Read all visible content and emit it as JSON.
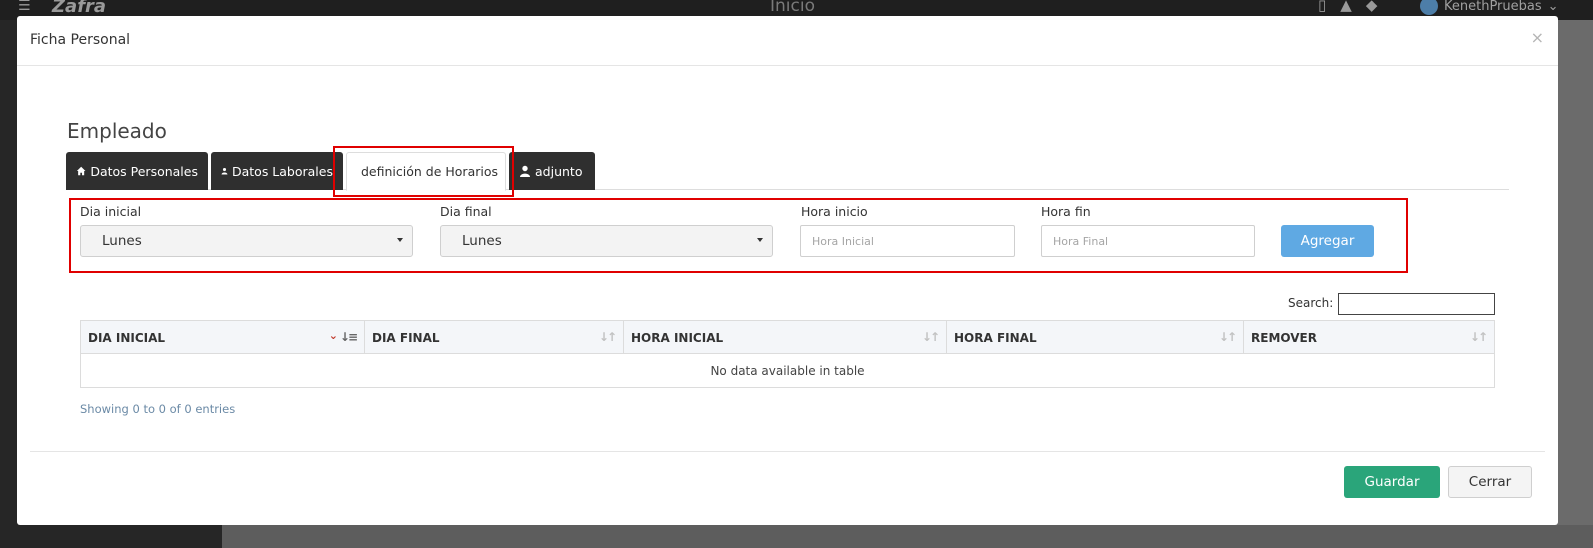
{
  "app": {
    "logo": "Zafra",
    "page_title": "Inicio",
    "user": "KenethPruebas"
  },
  "modal": {
    "title": "Ficha Personal",
    "close": "×"
  },
  "section_title": "Empleado",
  "tabs": [
    {
      "label": "Datos Personales",
      "icon": "home-icon"
    },
    {
      "label": "Datos Laborales",
      "icon": "user-icon"
    },
    {
      "label": "definición de Horarios",
      "icon": "user-icon",
      "active": true
    },
    {
      "label": "adjunto",
      "icon": "user-icon"
    }
  ],
  "form": {
    "dia_inicial_label": "Dia inicial",
    "dia_inicial_value": "Lunes",
    "dia_final_label": "Dia final",
    "dia_final_value": "Lunes",
    "hora_inicio_label": "Hora inicio",
    "hora_inicio_placeholder": "Hora Inicial",
    "hora_fin_label": "Hora fin",
    "hora_fin_placeholder": "Hora Final",
    "agregar": "Agregar"
  },
  "table": {
    "search_label": "Search:",
    "columns": [
      "DIA INICIAL",
      "DIA FINAL",
      "HORA INICIAL",
      "HORA FINAL",
      "REMOVER"
    ],
    "empty": "No data available in table",
    "info": "Showing 0 to 0 of 0 entries"
  },
  "footer": {
    "guardar": "Guardar",
    "cerrar": "Cerrar"
  },
  "colors": {
    "agregar": "#5fa9e3",
    "guardar": "#2aa57a",
    "highlight": "#e00000",
    "tab_dark": "#2f2f2f"
  }
}
